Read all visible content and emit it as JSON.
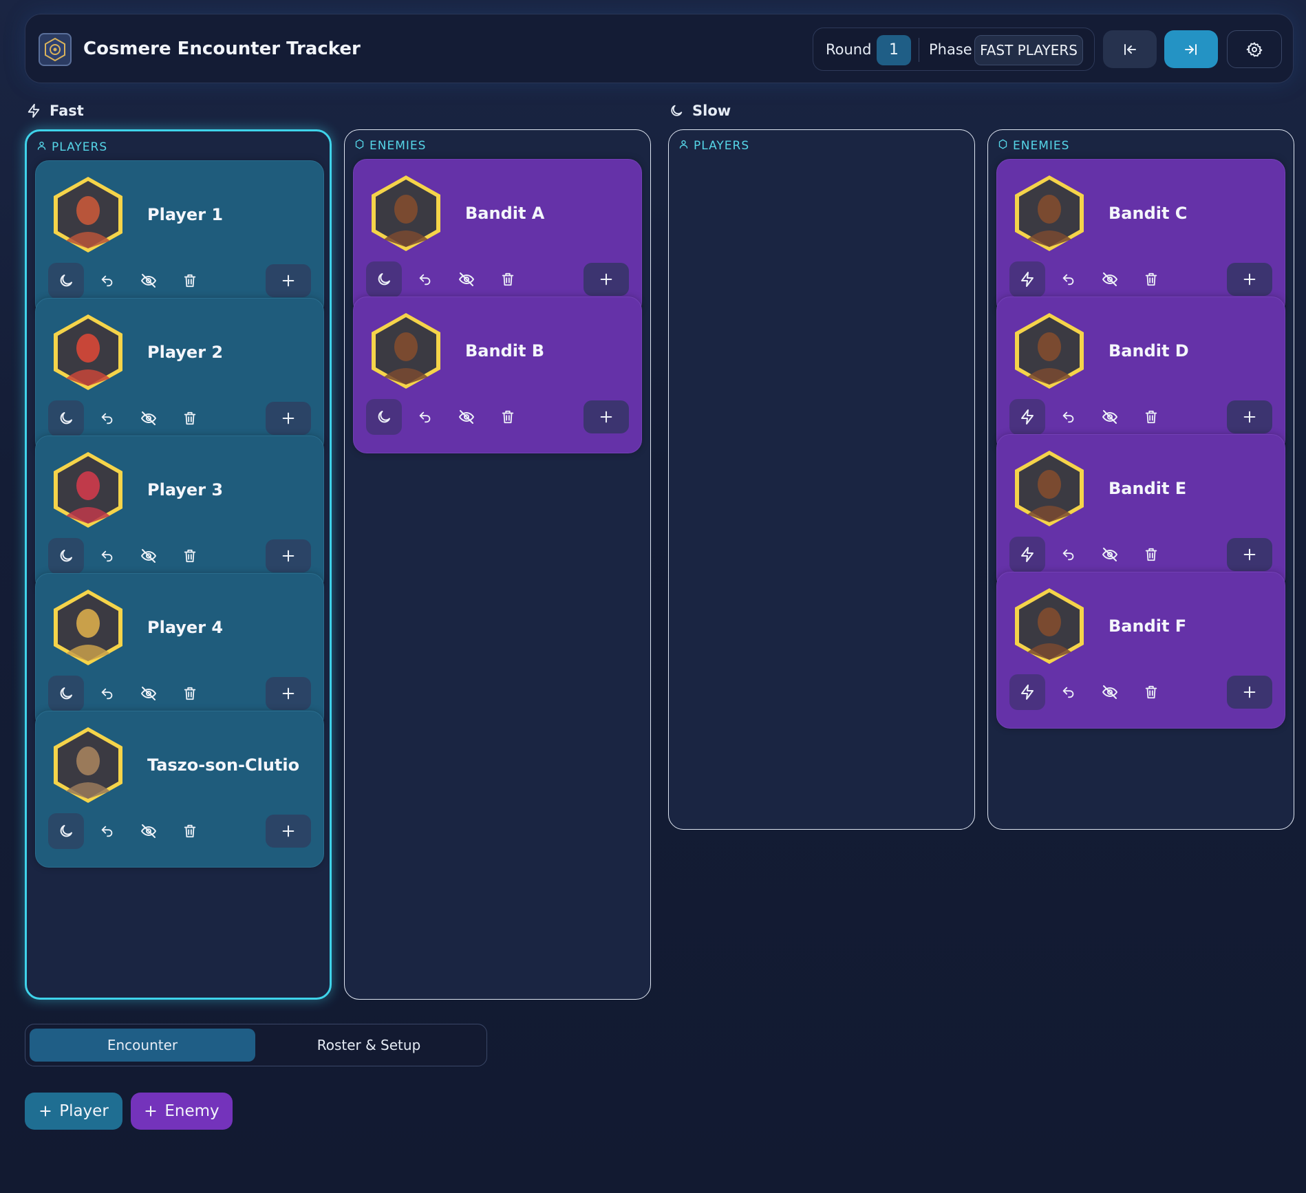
{
  "header": {
    "app_title": "Cosmere Encounter Tracker",
    "round_label": "Round",
    "round_value": "1",
    "phase_label": "Phase",
    "phase_value": "FAST PLAYERS",
    "icons": {
      "logo": "cosmere-logo-icon",
      "prev": "step-back-icon",
      "next": "step-forward-icon",
      "settings": "gear-icon"
    }
  },
  "sections": {
    "fast": {
      "label": "Fast",
      "icon": "lightning-icon"
    },
    "slow": {
      "label": "Slow",
      "icon": "moon-icon"
    }
  },
  "columns": [
    {
      "label": "PLAYERS",
      "kind": "player",
      "icon": "user-icon",
      "active": true,
      "cards": [
        {
          "name": "Player 1",
          "phase_icon": "moon-icon",
          "portrait_color": "#b8553a"
        },
        {
          "name": "Player 2",
          "phase_icon": "moon-icon",
          "portrait_color": "#c84638"
        },
        {
          "name": "Player 3",
          "phase_icon": "moon-icon",
          "portrait_color": "#c03a4a"
        },
        {
          "name": "Player 4",
          "phase_icon": "moon-icon",
          "portrait_color": "#c9a04a"
        },
        {
          "name": "Taszo-son-Clutio",
          "phase_icon": "moon-icon",
          "portrait_color": "#9a7a5a"
        }
      ]
    },
    {
      "label": "ENEMIES",
      "kind": "enemy",
      "icon": "shield-icon",
      "active": false,
      "cards": [
        {
          "name": "Bandit A",
          "phase_icon": "moon-icon",
          "portrait_color": "#7a4a30"
        },
        {
          "name": "Bandit B",
          "phase_icon": "moon-icon",
          "portrait_color": "#7a4a30"
        }
      ]
    },
    {
      "label": "PLAYERS",
      "kind": "player",
      "icon": "user-icon",
      "active": false,
      "cards": []
    },
    {
      "label": "ENEMIES",
      "kind": "enemy",
      "icon": "shield-icon",
      "active": false,
      "cards": [
        {
          "name": "Bandit C",
          "phase_icon": "lightning-icon",
          "portrait_color": "#7a4a30"
        },
        {
          "name": "Bandit D",
          "phase_icon": "lightning-icon",
          "portrait_color": "#7a4a30"
        },
        {
          "name": "Bandit E",
          "phase_icon": "lightning-icon",
          "portrait_color": "#7a4a30"
        },
        {
          "name": "Bandit F",
          "phase_icon": "lightning-icon",
          "portrait_color": "#7a4a30"
        }
      ]
    }
  ],
  "tabs": {
    "encounter": "Encounter",
    "roster": "Roster & Setup"
  },
  "actions": {
    "add_player": "Player",
    "add_enemy": "Enemy"
  },
  "colors": {
    "accent": "#3fd3ea",
    "player_card": "#1f5c7c",
    "enemy_card": "#6532a8",
    "next_button": "#2493c4",
    "add_enemy_button": "#7433bb",
    "portrait_frame": "#f5d44a"
  }
}
